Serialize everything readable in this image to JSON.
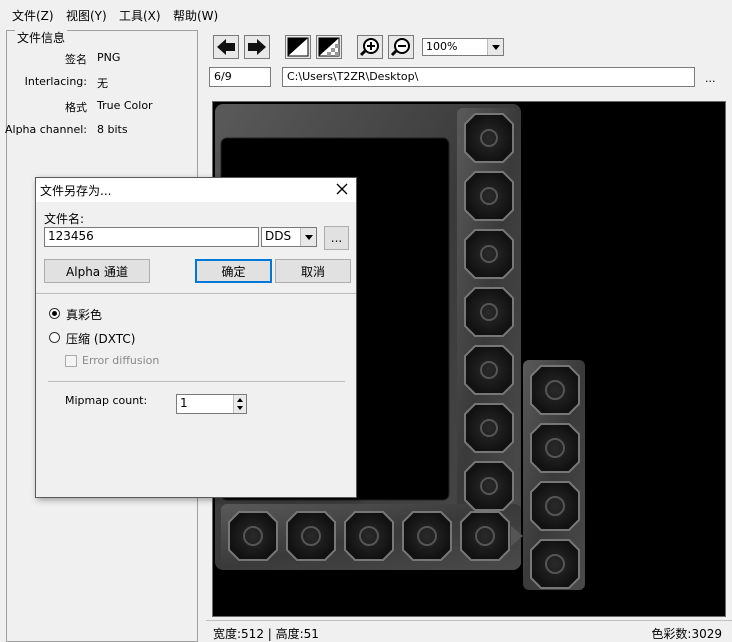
{
  "menu": [
    "文件(Z)",
    "视图(Y)",
    "工具(X)",
    "帮助(W)"
  ],
  "file_info": {
    "title": "文件信息",
    "rows": [
      {
        "label": "签名",
        "value": "PNG"
      },
      {
        "label": "Interlacing:",
        "value": "无"
      },
      {
        "label": "格式",
        "value": "True Color"
      },
      {
        "label": "Alpha channel:",
        "value": "8 bits"
      }
    ]
  },
  "toolbar": {
    "zoom": "100%",
    "page": "6/9",
    "path": "C:\\Users\\T2ZR\\Desktop\\",
    "more": "..."
  },
  "status": {
    "dimensions": "宽度:512 | 高度:51",
    "colors": "色彩数:3029"
  },
  "dialog": {
    "title": "文件另存为...",
    "filename_label": "文件名:",
    "filename_value": "123456",
    "format_value": "DDS",
    "browse_label": "...",
    "alpha_button": "Alpha 通道",
    "ok_button": "确定",
    "cancel_button": "取消",
    "radio_truecolor": "真彩色",
    "radio_compress": "压缩 (DXTC)",
    "error_diffusion": "Error diffusion",
    "mipmap_label": "Mipmap count:",
    "mipmap_value": "1"
  }
}
